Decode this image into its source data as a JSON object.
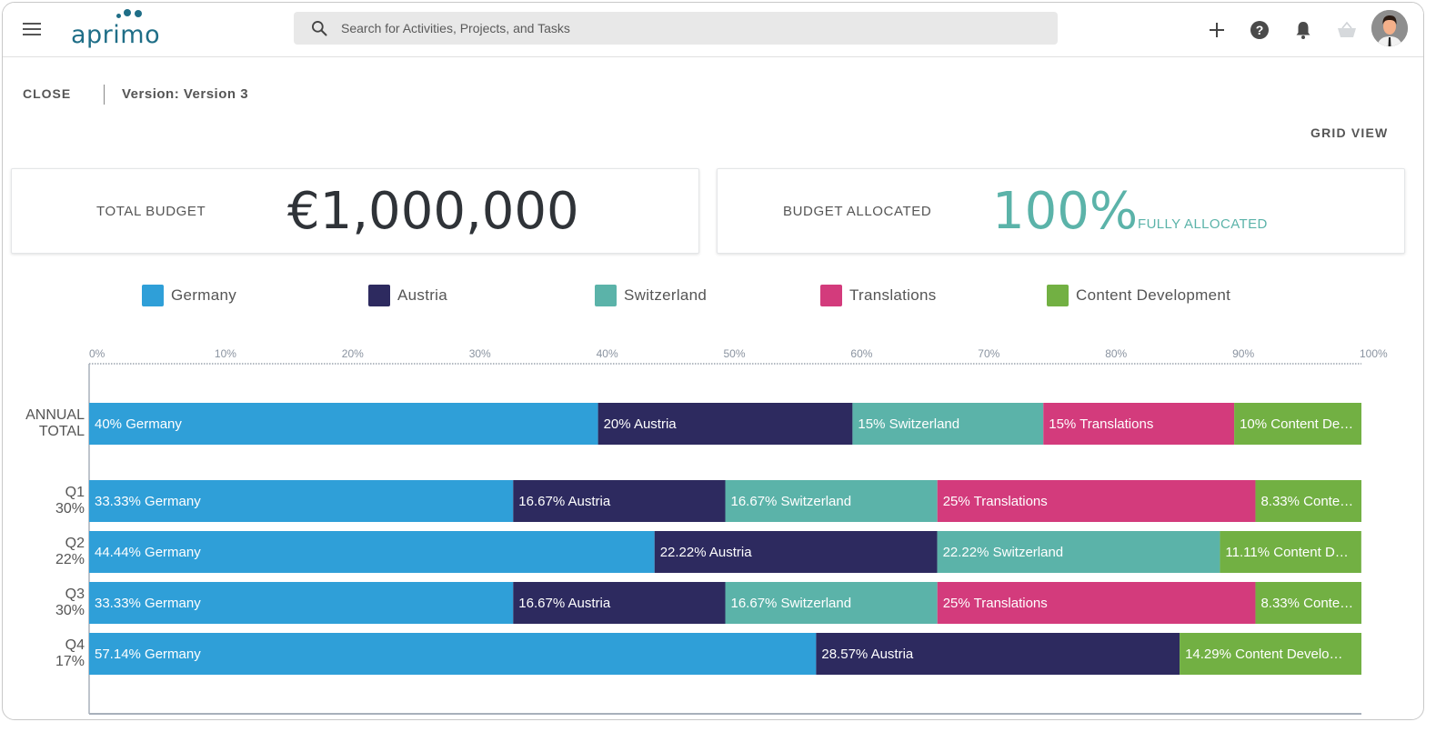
{
  "header": {
    "logo_text": "aprimo",
    "search_placeholder": "Search for Activities, Projects, and Tasks",
    "icons": [
      "menu-icon",
      "search-icon",
      "plus-icon",
      "help-icon",
      "bell-icon",
      "basket-icon",
      "user-avatar"
    ]
  },
  "subheader": {
    "close_label": "CLOSE",
    "version_label": "Version: Version 3",
    "grid_view_label": "GRID VIEW"
  },
  "cards": {
    "total_budget": {
      "label": "TOTAL BUDGET",
      "value": "€1,000,000"
    },
    "budget_allocated": {
      "label": "BUDGET ALLOCATED",
      "value": "100%",
      "status": "FULLY ALLOCATED",
      "color": "#5bb3a9"
    }
  },
  "chart_data": {
    "type": "bar",
    "orientation": "horizontal",
    "stacked": true,
    "title": "",
    "xlabel": "",
    "ylabel": "",
    "xlim": [
      0,
      100
    ],
    "x_ticks": [
      "0%",
      "10%",
      "20%",
      "30%",
      "40%",
      "50%",
      "60%",
      "70%",
      "80%",
      "90%",
      "100%"
    ],
    "grid": false,
    "legend_position": "top",
    "legend": [
      {
        "name": "Germany",
        "color": "#2f9fd8"
      },
      {
        "name": "Austria",
        "color": "#2d2a5f"
      },
      {
        "name": "Switzerland",
        "color": "#5bb3a9"
      },
      {
        "name": "Translations",
        "color": "#d33b7c"
      },
      {
        "name": "Content Development",
        "color": "#72b043"
      }
    ],
    "categories": [
      {
        "label": [
          "ANNUAL",
          "TOTAL"
        ]
      },
      {
        "label": [
          "Q1",
          "30%"
        ]
      },
      {
        "label": [
          "Q2",
          "22%"
        ]
      },
      {
        "label": [
          "Q3",
          "30%"
        ]
      },
      {
        "label": [
          "Q4",
          "17%"
        ]
      }
    ],
    "series": [
      {
        "name": "Germany",
        "values": [
          40,
          33.33,
          44.44,
          33.33,
          57.14
        ],
        "labels": [
          "40% Germany",
          "33.33% Germany",
          "44.44% Germany",
          "33.33% Germany",
          "57.14% Germany"
        ]
      },
      {
        "name": "Austria",
        "values": [
          20,
          16.67,
          22.22,
          16.67,
          28.57
        ],
        "labels": [
          "20% Austria",
          "16.67% Austria",
          "22.22% Austria",
          "16.67% Austria",
          "28.57% Austria"
        ]
      },
      {
        "name": "Switzerland",
        "values": [
          15,
          16.67,
          22.22,
          16.67,
          0
        ],
        "labels": [
          "15% Switzerland",
          "16.67% Switzerland",
          "22.22% Switzerland",
          "16.67% Switzerland",
          ""
        ]
      },
      {
        "name": "Translations",
        "values": [
          15,
          25,
          0,
          25,
          0
        ],
        "labels": [
          "15% Translations",
          "25% Translations",
          "",
          "25% Translations",
          ""
        ]
      },
      {
        "name": "Content Development",
        "values": [
          10,
          8.33,
          11.11,
          8.33,
          14.29
        ],
        "labels": [
          "10% Content De…",
          "8.33% Conte…",
          "11.11% Content D…",
          "8.33% Conte…",
          "14.29% Content Develo…"
        ]
      }
    ]
  }
}
